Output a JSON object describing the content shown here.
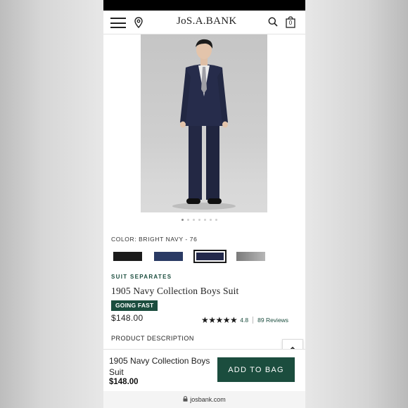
{
  "header": {
    "logo": "JoS.A.BANK",
    "bag_count": "0"
  },
  "product": {
    "color_label": "COLOR: BRIGHT NAVY - 76",
    "swatches": [
      "black",
      "navy",
      "bright-navy-selected",
      "grey"
    ],
    "category": "SUIT SEPARATES",
    "name": "1905 Navy Collection Boys Suit",
    "badge": "GOING FAST",
    "price": "$148.00",
    "rating_value": "4.8",
    "reviews": "89 Reviews",
    "description_title": "PRODUCT DESCRIPTION",
    "image_pages": 7,
    "image_active_page": 1
  },
  "bottom_bar": {
    "name": "1905 Navy Collection Boys Suit",
    "price": "$148.00",
    "add_to_bag": "ADD TO BAG"
  },
  "browser": {
    "url": "josbank.com"
  },
  "colors": {
    "brand_green": "#1b4d3e",
    "navy": "#2a3a64"
  },
  "icons": [
    "menu-icon",
    "location-pin-icon",
    "search-icon",
    "shopping-bag-icon",
    "chevron-up-icon",
    "lock-icon",
    "star-icon"
  ]
}
